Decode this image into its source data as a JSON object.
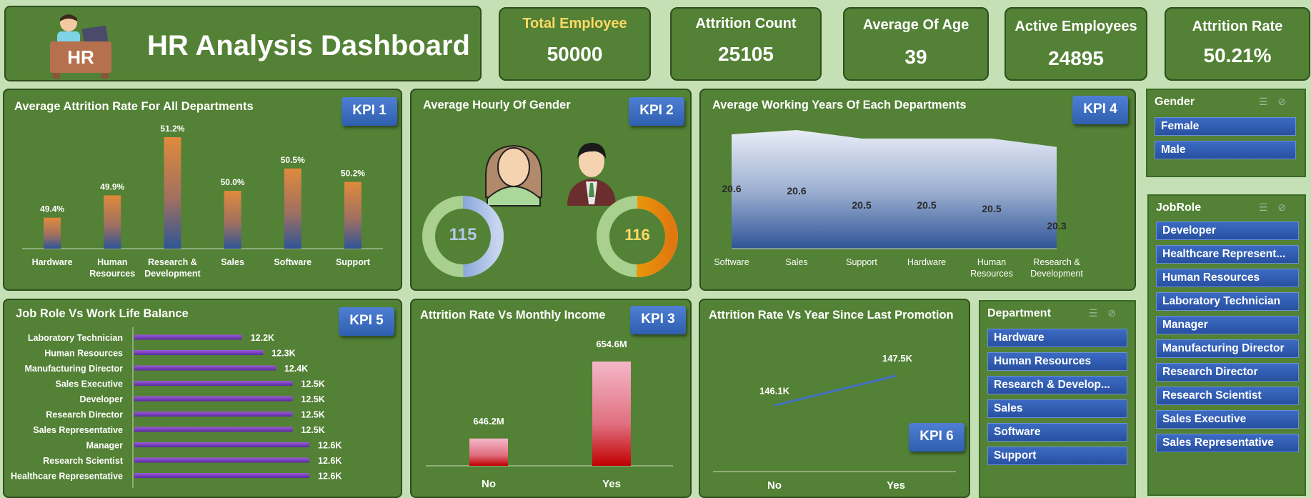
{
  "header": {
    "title": "HR Analysis Dashboard",
    "logo_text": "HR"
  },
  "cards": [
    {
      "label": "Total Employee",
      "value": "50000",
      "label_color": "#ffd966"
    },
    {
      "label": "Attrition Count",
      "value": "25105",
      "label_color": "#ffffff"
    },
    {
      "label": "Average Of Age",
      "value": "39",
      "label_color": "#ffffff"
    },
    {
      "label": "Active Employees",
      "value": "24895",
      "label_color": "#ffffff"
    },
    {
      "label": "Attrition Rate",
      "value": "50.21%",
      "label_color": "#ffffff"
    }
  ],
  "kpi": {
    "k1": "KPI 1",
    "k2": "KPI 2",
    "k3": "KPI 3",
    "k4": "KPI 4",
    "k5": "KPI 5",
    "k6": "KPI 6"
  },
  "panels": {
    "attr_dept": {
      "title": "Average Attrition Rate For All Departments"
    },
    "gender": {
      "title": "Average Hourly Of Gender",
      "female_value": "115",
      "male_value": "116"
    },
    "working_years": {
      "title": "Average Working Years Of Each Departments"
    },
    "job_role": {
      "title": "Job Role Vs Work Life Balance"
    },
    "monthly_income": {
      "title": "Attrition Rate Vs Monthly Income"
    },
    "promotion": {
      "title": "Attrition Rate Vs Year Since Last Promotion"
    }
  },
  "chart_data": [
    {
      "type": "bar",
      "title": "Average Attrition Rate For All Departments",
      "categories": [
        "Hardware",
        "Human Resources",
        "Research & Development",
        "Sales",
        "Software",
        "Support"
      ],
      "tick_lines": [
        [
          "Hardware"
        ],
        [
          "Human",
          "Resources"
        ],
        [
          "Research &",
          "Development"
        ],
        [
          "Sales"
        ],
        [
          "Software"
        ],
        [
          "Support"
        ]
      ],
      "values": [
        49.4,
        49.9,
        51.2,
        50.0,
        50.5,
        50.2
      ],
      "labels": [
        "49.4%",
        "49.9%",
        "51.2%",
        "50.0%",
        "50.5%",
        "50.2%"
      ]
    },
    {
      "type": "pie",
      "title": "Average Hourly Of Gender",
      "categories": [
        "Female",
        "Male"
      ],
      "values": [
        115,
        116
      ]
    },
    {
      "type": "area",
      "title": "Average Working Years Of Each Departments",
      "categories": [
        "Software",
        "Sales",
        "Support",
        "Hardware",
        "Human Resources",
        "Research & Development"
      ],
      "tick_lines": [
        [
          "Software"
        ],
        [
          "Sales"
        ],
        [
          "Support"
        ],
        [
          "Hardware"
        ],
        [
          "Human",
          "Resources"
        ],
        [
          "Research &",
          "Development"
        ]
      ],
      "values": [
        20.6,
        20.6,
        20.5,
        20.5,
        20.5,
        20.3
      ],
      "labels": [
        "20.6",
        "20.6",
        "20.5",
        "20.5",
        "20.5",
        "20.3"
      ]
    },
    {
      "type": "bar",
      "orientation": "horizontal",
      "title": "Job Role Vs Work Life Balance",
      "categories": [
        "Laboratory Technician",
        "Human Resources",
        "Manufacturing Director",
        "Sales Executive",
        "Developer",
        "Research Director",
        "Sales Representative",
        "Manager",
        "Research Scientist",
        "Healthcare Representative"
      ],
      "values": [
        12.2,
        12.3,
        12.4,
        12.5,
        12.5,
        12.5,
        12.5,
        12.6,
        12.6,
        12.6
      ],
      "labels": [
        "12.2K",
        "12.3K",
        "12.4K",
        "12.5K",
        "12.5K",
        "12.5K",
        "12.5K",
        "12.6K",
        "12.6K",
        "12.6K"
      ]
    },
    {
      "type": "bar",
      "title": "Attrition Rate Vs Monthly Income",
      "categories": [
        "No",
        "Yes"
      ],
      "values": [
        646.2,
        654.6
      ],
      "labels": [
        "646.2M",
        "654.6M"
      ]
    },
    {
      "type": "line",
      "title": "Attrition Rate Vs Year Since Last Promotion",
      "categories": [
        "No",
        "Yes"
      ],
      "values": [
        146.1,
        147.5
      ],
      "labels": [
        "146.1K",
        "147.5K"
      ]
    }
  ],
  "slicers": {
    "gender": {
      "title": "Gender",
      "items": [
        "Female",
        "Male"
      ]
    },
    "jobrole": {
      "title": "JobRole",
      "items": [
        "Developer",
        "Healthcare Represent...",
        "Human Resources",
        "Laboratory Technician",
        "Manager",
        "Manufacturing Director",
        "Research Director",
        "Research Scientist",
        "Sales Executive",
        "Sales Representative"
      ]
    },
    "department": {
      "title": "Department",
      "items": [
        "Hardware",
        "Human Resources",
        "Research & Develop...",
        "Sales",
        "Software",
        "Support"
      ]
    }
  },
  "colors": {
    "panel_bg": "#538135",
    "page_bg": "#c5e0b4",
    "kpi_blue": "#3a6bc2",
    "accent_gold": "#ffd966"
  }
}
